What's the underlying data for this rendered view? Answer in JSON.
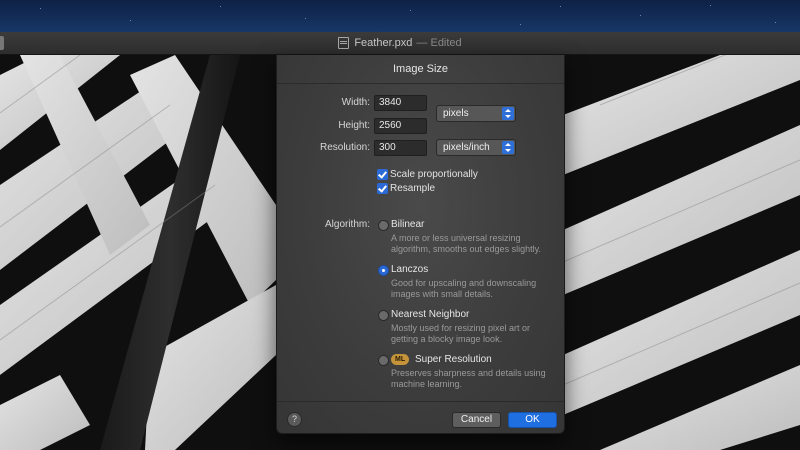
{
  "window": {
    "title": "Feather.pxd",
    "status": "— Edited",
    "doc_icon": "document-icon"
  },
  "dialog": {
    "title": "Image Size",
    "width": {
      "label": "Width:",
      "value": "3840"
    },
    "height": {
      "label": "Height:",
      "value": "2560"
    },
    "size_unit": "pixels",
    "resolution": {
      "label": "Resolution:",
      "value": "300",
      "unit": "pixels/inch"
    },
    "scale_proportionally": {
      "label": "Scale proportionally",
      "checked": true
    },
    "resample": {
      "label": "Resample",
      "checked": true
    },
    "algorithm_label": "Algorithm:",
    "algorithms": [
      {
        "name": "Bilinear",
        "desc": "A more or less universal resizing algorithm, smooths out edges slightly.",
        "selected": false
      },
      {
        "name": "Lanczos",
        "desc": "Good for upscaling and downscaling images with small details.",
        "selected": true
      },
      {
        "name": "Nearest Neighbor",
        "desc": "Mostly used for resizing pixel art or getting a blocky image look.",
        "selected": false
      },
      {
        "name": "Super Resolution",
        "badge": "ML",
        "desc": "Preserves sharpness and details using machine learning.",
        "selected": false
      }
    ],
    "help": "?",
    "cancel": "Cancel",
    "ok": "OK"
  },
  "colors": {
    "accent": "#1f6fe0",
    "ml_badge": "#c4933a"
  }
}
